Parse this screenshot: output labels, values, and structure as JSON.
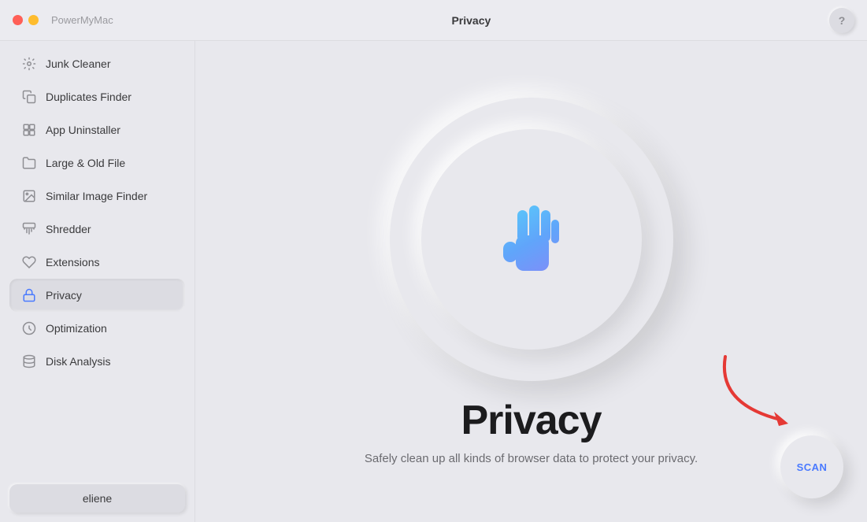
{
  "titlebar": {
    "app_name": "PowerMyMac",
    "center_title": "Privacy",
    "help_label": "?"
  },
  "sidebar": {
    "items": [
      {
        "id": "junk-cleaner",
        "label": "Junk Cleaner",
        "icon": "gear"
      },
      {
        "id": "duplicates-finder",
        "label": "Duplicates Finder",
        "icon": "copy"
      },
      {
        "id": "app-uninstaller",
        "label": "App Uninstaller",
        "icon": "app"
      },
      {
        "id": "large-old-file",
        "label": "Large & Old File",
        "icon": "file"
      },
      {
        "id": "similar-image-finder",
        "label": "Similar Image Finder",
        "icon": "image"
      },
      {
        "id": "shredder",
        "label": "Shredder",
        "icon": "shred"
      },
      {
        "id": "extensions",
        "label": "Extensions",
        "icon": "ext"
      },
      {
        "id": "privacy",
        "label": "Privacy",
        "icon": "privacy",
        "active": true
      },
      {
        "id": "optimization",
        "label": "Optimization",
        "icon": "opt"
      },
      {
        "id": "disk-analysis",
        "label": "Disk Analysis",
        "icon": "disk"
      }
    ],
    "footer_user": "eliene"
  },
  "main": {
    "title": "Privacy",
    "subtitle": "Safely clean up all kinds of browser data to protect your privacy.",
    "scan_label": "SCAN"
  }
}
